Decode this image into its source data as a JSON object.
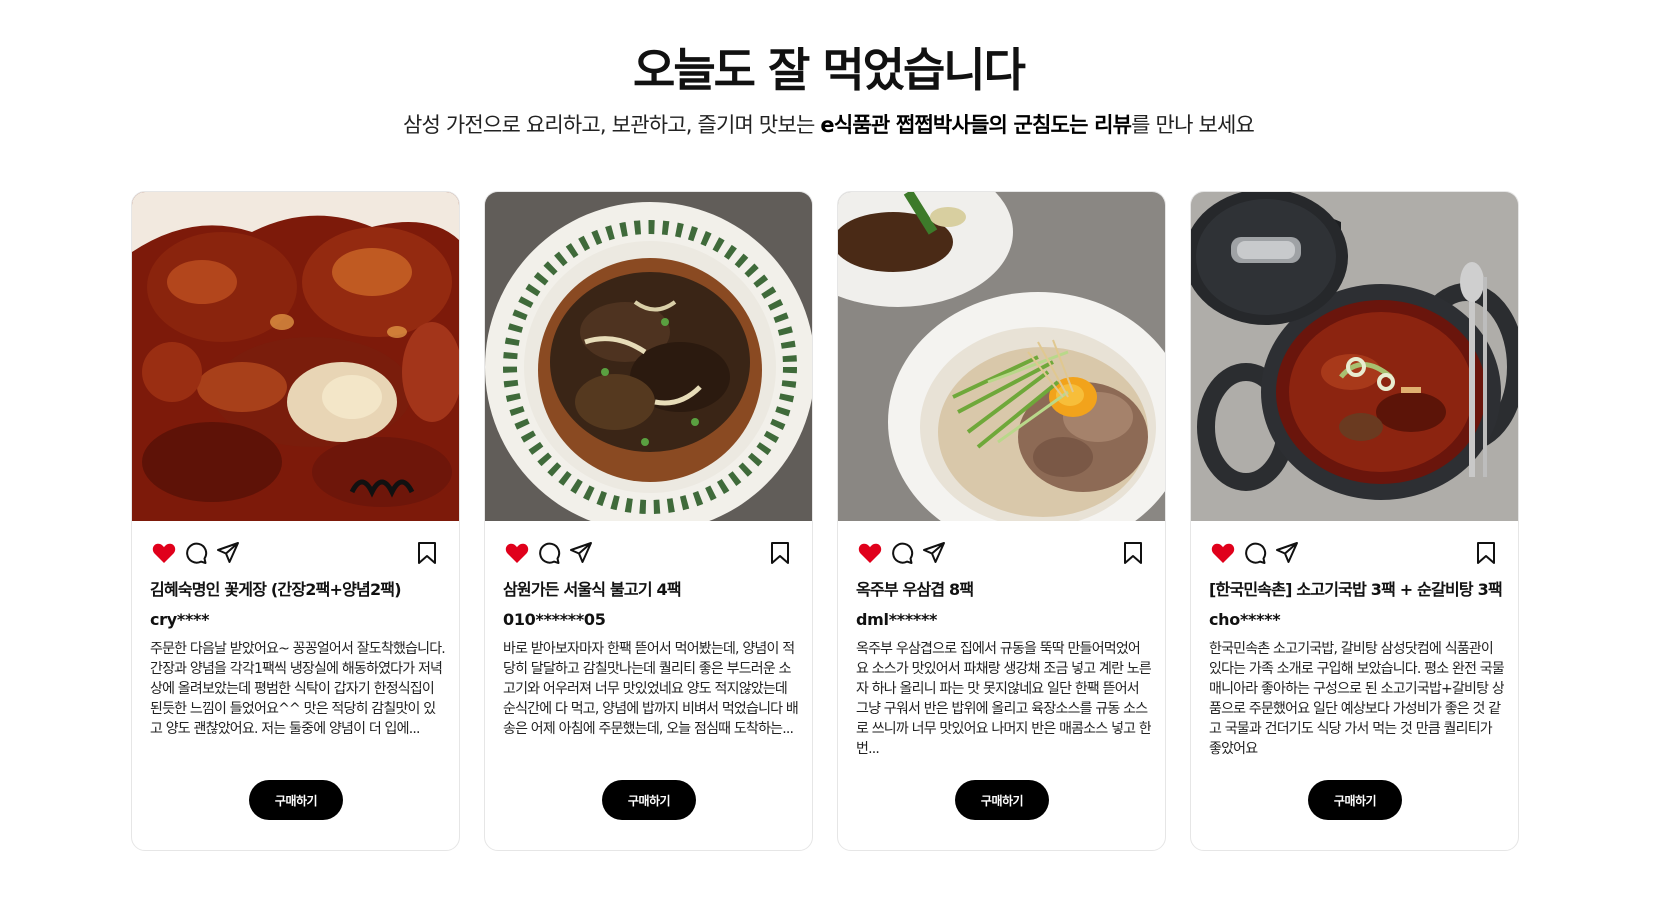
{
  "header": {
    "title": "오늘도 잘 먹었습니다",
    "subtitle_prefix": "삼성 가전으로 요리하고, 보관하고, 즐기며 맛보는 ",
    "subtitle_bold": "e식품관 쩝쩝박사들의 군침도는 리뷰",
    "subtitle_suffix": "를 만나 보세요"
  },
  "colors": {
    "heart": "#e0001b",
    "button_bg": "#000000",
    "button_text": "#ffffff"
  },
  "icons": [
    "heart-icon",
    "comment-icon",
    "share-icon",
    "bookmark-icon"
  ],
  "reviews": [
    {
      "product": "김혜숙명인 꽃게장 (간장2팩+양념2팩)",
      "user": "cry****",
      "text": "주문한 다음날 받았어요~ 꽁꽁얼어서 잘도착했습니다. 간장과 양념을 각각1팩씩 냉장실에 해동하였다가 저녁상에 올려보았는데 평범한 식탁이 갑자기 한정식집이 된듯한 느낌이 들었어요^^ 맛은 적당히 감칠맛이 있고 양도 괜찮았어요. 저는 둘중에 양념이 더 입에...",
      "button": "구매하기"
    },
    {
      "product": "삼원가든 서울식 불고기 4팩",
      "user": "010******05",
      "text": "바로 받아보자마자 한팩 뜯어서 먹어봤는데, 양념이 적당히 달달하고 감칠맛나는데 퀄리티 좋은 부드러운 소고기와 어우러져 너무 맛있었네요 양도 적지않았는데 순식간에 다 먹고, 양념에 밥까지 비벼서 먹었습니다 배송은 어제 아침에 주문했는데, 오늘 점심때 도착하는...",
      "button": "구매하기"
    },
    {
      "product": "옥주부 우삼겹 8팩",
      "user": "dml******",
      "text": "옥주부 우삼겹으로 집에서 규동을 뚝딱 만들어먹었어요 소스가 맛있어서 파채랑 생강채 조금 넣고 계란 노른자 하나 올리니 파는 맛 못지않네요 일단 한팩 뜯어서 그냥 구워서 반은 밥위에 올리고 육장소스를 규동 소스로 쓰니까 너무 맛있어요 나머지 반은 매콤소스 넣고 한번...",
      "button": "구매하기"
    },
    {
      "product": "[한국민속촌] 소고기국밥 3팩 + 순갈비탕 3팩",
      "user": "cho*****",
      "text": "한국민속촌 소고기국밥, 갈비탕 삼성닷컴에 식품관이 있다는 가족 소개로 구입해 보았습니다. 평소 완전 국물 매니아라 좋아하는 구성으로 된 소고기국밥+갈비탕 상품으로 주문했어요 일단 예상보다 가성비가 좋은 것 같고 국물과 건더기도 식당 가서 먹는 것 만큼 퀄리티가 좋았어요",
      "button": "구매하기"
    }
  ]
}
